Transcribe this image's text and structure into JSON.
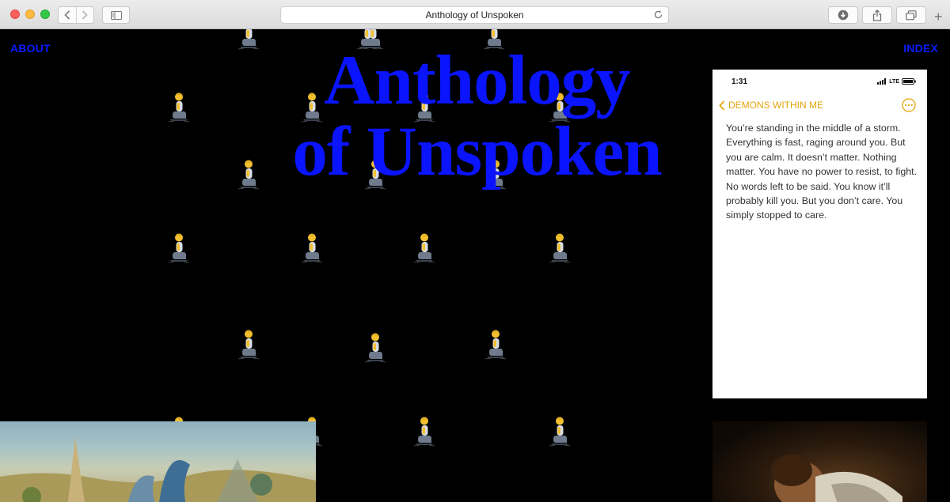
{
  "browser": {
    "url_title": "Anthology of Unspoken"
  },
  "nav": {
    "about": "ABOUT",
    "index": "INDEX"
  },
  "hero": {
    "line1": "Anthology",
    "line2": "of Unspoken"
  },
  "figures": {
    "icon": "kneeling-person-icon",
    "count": 22
  },
  "note_card": {
    "time": "1:31",
    "network": "LTE",
    "back_label": "DEMONS WITHIN ME",
    "body": "You’re standing in the middle of a storm. Everything is fast, raging around you. But you are calm. It doesn’t matter. Nothing matter. You have no power to resist, to fight. No words left to be said. You know it’ll probably kill you. But you don’t care. You simply stopped to care."
  },
  "colors": {
    "background": "#000000",
    "accent_blue": "#0a14ff",
    "notes_yellow": "#e4a50a"
  }
}
